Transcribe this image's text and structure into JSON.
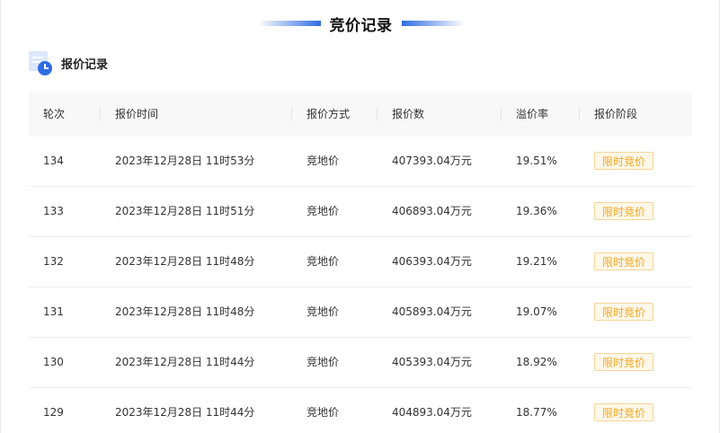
{
  "page": {
    "title": "竞价记录"
  },
  "section": {
    "label": "报价记录",
    "icon": "record-list-icon"
  },
  "table": {
    "headers": {
      "round": "轮次",
      "time": "报价时间",
      "method": "报价方式",
      "amount": "报价数",
      "premium": "溢价率",
      "stage": "报价阶段"
    },
    "rows": [
      {
        "round": "134",
        "time": "2023年12月28日 11时53分",
        "method": "竞地价",
        "amount": "407393.04万元",
        "premium": "19.51%",
        "stage": "限时竞价"
      },
      {
        "round": "133",
        "time": "2023年12月28日 11时51分",
        "method": "竞地价",
        "amount": "406893.04万元",
        "premium": "19.36%",
        "stage": "限时竞价"
      },
      {
        "round": "132",
        "time": "2023年12月28日 11时48分",
        "method": "竞地价",
        "amount": "406393.04万元",
        "premium": "19.21%",
        "stage": "限时竞价"
      },
      {
        "round": "131",
        "time": "2023年12月28日 11时48分",
        "method": "竞地价",
        "amount": "405893.04万元",
        "premium": "19.07%",
        "stage": "限时竞价"
      },
      {
        "round": "130",
        "time": "2023年12月28日 11时44分",
        "method": "竞地价",
        "amount": "405393.04万元",
        "premium": "18.92%",
        "stage": "限时竞价"
      },
      {
        "round": "129",
        "time": "2023年12月28日 11时44分",
        "method": "竞地价",
        "amount": "404893.04万元",
        "premium": "18.77%",
        "stage": "限时竞价"
      }
    ]
  },
  "colors": {
    "accent": "#2f6ce2",
    "stage_text": "#f5a623",
    "stage_bg": "#fff8e8",
    "stage_border": "#f8d59a",
    "header_bg": "#f8f8f8"
  }
}
